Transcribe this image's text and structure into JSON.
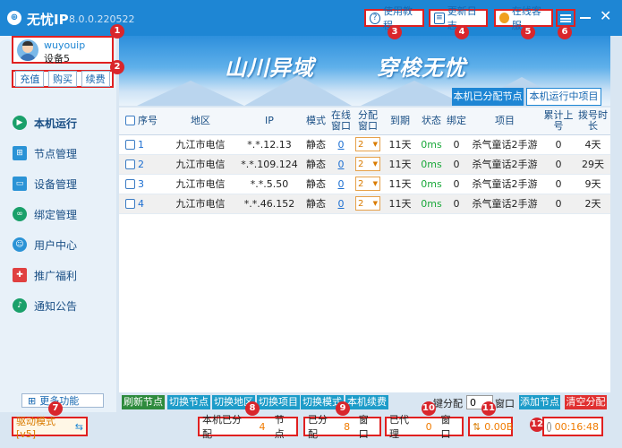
{
  "app": {
    "title": "无忧IP",
    "version": "8.0.0.220522"
  },
  "header": {
    "help_label": "使用教程",
    "changelog_label": "更新日志",
    "service_label": "在线客服"
  },
  "user": {
    "name": "wuyouip",
    "device": "设备5"
  },
  "account": {
    "recharge": "充值",
    "buy": "购买",
    "renew": "续费"
  },
  "sidebar": {
    "items": [
      {
        "label": "本机运行",
        "icon": "play-icon",
        "active": true
      },
      {
        "label": "节点管理",
        "icon": "node-icon"
      },
      {
        "label": "设备管理",
        "icon": "device-icon"
      },
      {
        "label": "绑定管理",
        "icon": "bind-icon"
      },
      {
        "label": "用户中心",
        "icon": "user-icon"
      },
      {
        "label": "推广福利",
        "icon": "gift-icon"
      },
      {
        "label": "通知公告",
        "icon": "bell-icon"
      }
    ],
    "more": "更多功能"
  },
  "banner": {
    "slogan_left": "山川异域",
    "slogan_right": "穿梭无忧"
  },
  "tabs": [
    "本机已分配节点",
    "本机运行中项目"
  ],
  "table": {
    "headers": [
      "序号",
      "地区",
      "IP",
      "模式",
      "在线窗口",
      "分配窗口",
      "到期",
      "状态",
      "绑定",
      "项目",
      "累计上号",
      "拨号时长"
    ],
    "rows": [
      {
        "no": "1",
        "region": "九江市电信",
        "ip": "*.*.12.13",
        "mode": "静态",
        "online": "0",
        "alloc": "2",
        "expire": "11天",
        "status": "0ms",
        "bind": "0",
        "project": "杀气童话2手游",
        "total": "0",
        "dial": "4天"
      },
      {
        "no": "2",
        "region": "九江市电信",
        "ip": "*.*.109.124",
        "mode": "静态",
        "online": "0",
        "alloc": "2",
        "expire": "11天",
        "status": "0ms",
        "bind": "0",
        "project": "杀气童话2手游",
        "total": "0",
        "dial": "29天"
      },
      {
        "no": "3",
        "region": "九江市电信",
        "ip": "*.*.5.50",
        "mode": "静态",
        "online": "0",
        "alloc": "2",
        "expire": "11天",
        "status": "0ms",
        "bind": "0",
        "project": "杀气童话2手游",
        "total": "0",
        "dial": "9天"
      },
      {
        "no": "4",
        "region": "九江市电信",
        "ip": "*.*.46.152",
        "mode": "静态",
        "online": "0",
        "alloc": "2",
        "expire": "11天",
        "status": "0ms",
        "bind": "0",
        "project": "杀气童话2手游",
        "total": "0",
        "dial": "2天"
      }
    ]
  },
  "actions": {
    "refresh": "刷新节点",
    "switch_node": "切换节点",
    "switch_region": "切换地区",
    "switch_project": "切换项目",
    "switch_mode": "切换模式",
    "renew": "本机续费",
    "batch_label": "键分配",
    "batch_value": "0",
    "window_label": "窗口",
    "add_node": "添加节点",
    "clear": "清空分配"
  },
  "status": {
    "driver_mode": "驱动模式[v5]",
    "assigned_label": "本机已分配",
    "assigned_value": "4",
    "assigned_unit": "节点",
    "alloc_label": "已分配",
    "alloc_value": "8",
    "alloc_unit": "窗口",
    "proxy_label": "已代理",
    "proxy_value": "0",
    "proxy_unit": "窗口",
    "traffic": "0.00B",
    "timer": "00:16:48"
  },
  "markers": [
    "1",
    "2",
    "3",
    "4",
    "5",
    "6",
    "7",
    "8",
    "9",
    "10",
    "11",
    "12"
  ],
  "colors": {
    "accent": "#1e86d4",
    "marker": "#d9262c",
    "highlight": "#e02020",
    "green_button": "#2e8b3d",
    "red_button": "#e03030"
  }
}
